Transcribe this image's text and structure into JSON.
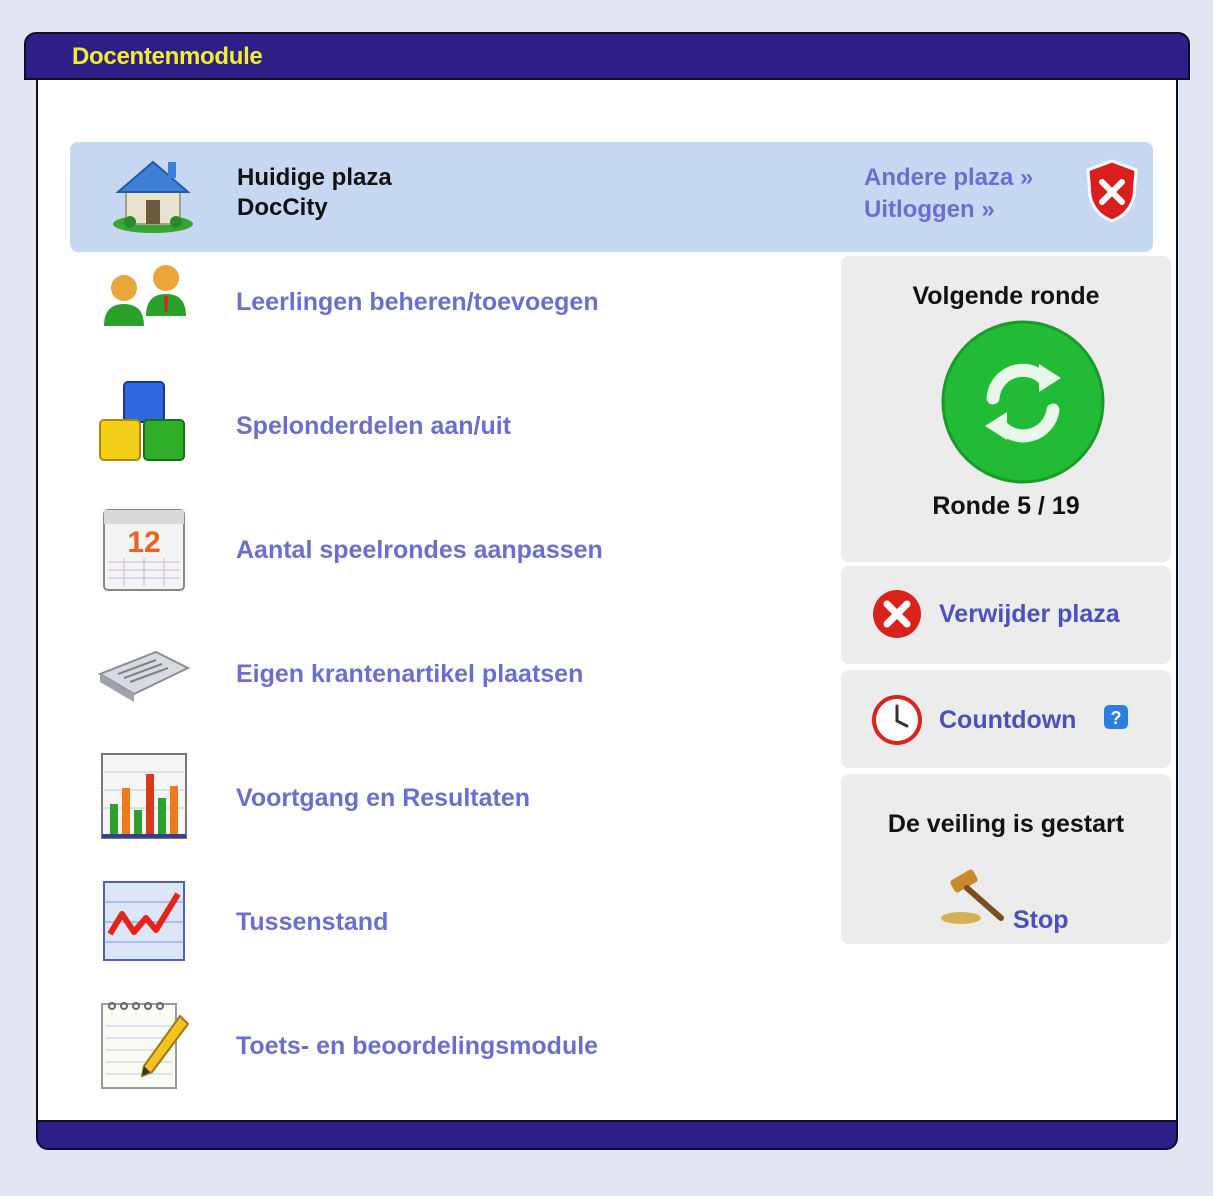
{
  "window": {
    "title": "Docentenmodule"
  },
  "plaza": {
    "label": "Huidige plaza",
    "name": "DocCity",
    "other_link": "Andere plaza »",
    "logout_link": "Uitloggen »"
  },
  "menu": [
    {
      "label": "Leerlingen beheren/toevoegen",
      "icon": "users-icon"
    },
    {
      "label": "Spelonderdelen aan/uit",
      "icon": "blocks-icon"
    },
    {
      "label": "Aantal speelrondes aanpassen",
      "icon": "calendar-icon"
    },
    {
      "label": "Eigen krantenartikel plaatsen",
      "icon": "newspaper-icon"
    },
    {
      "label": "Voortgang en Resultaten",
      "icon": "bar-chart-icon"
    },
    {
      "label": "Tussenstand",
      "icon": "line-chart-icon"
    },
    {
      "label": "Toets- en beoordelingsmodule",
      "icon": "notepad-icon"
    }
  ],
  "round": {
    "heading": "Volgende ronde",
    "status": "Ronde 5 / 19"
  },
  "actions": {
    "delete_plaza": "Verwijder plaza",
    "countdown": "Countdown"
  },
  "auction": {
    "heading": "De veiling is gestart",
    "stop": "Stop"
  },
  "colors": {
    "title_bar": "#2e1f87",
    "title_text": "#f2ef2e",
    "link": "#6a6fcf",
    "plaza_bg": "#c7d9f2",
    "next_round_button": "#22bb35"
  }
}
